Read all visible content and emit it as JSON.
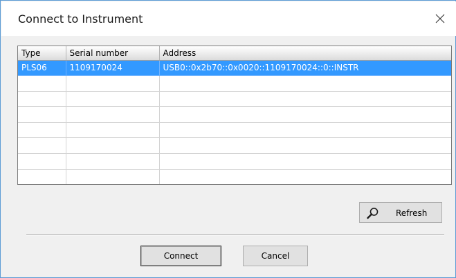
{
  "dialog": {
    "title": "Connect to Instrument"
  },
  "icons": {
    "close": "close-icon",
    "refresh": "magnifier-icon"
  },
  "grid": {
    "columns": [
      "Type",
      "Serial number",
      "Address"
    ],
    "rows": [
      [
        "PLS06",
        "1109170024",
        "USB0::0x2b70::0x0020::1109170024::0::INSTR"
      ]
    ],
    "selected_row": 0
  },
  "buttons": {
    "refresh": "Refresh",
    "connect": "Connect",
    "cancel": "Cancel"
  },
  "colors": {
    "selection": "#3399ff",
    "window_border": "#5b9bd5"
  }
}
